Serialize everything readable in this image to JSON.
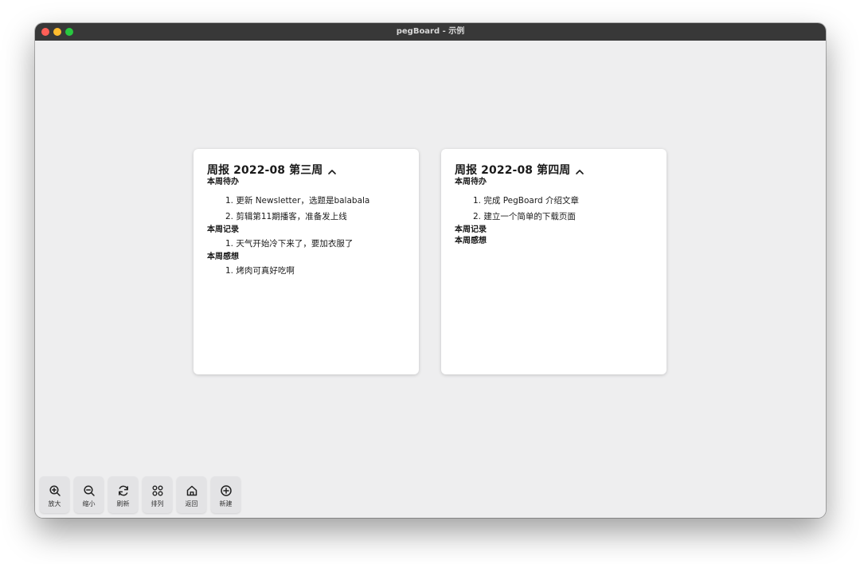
{
  "window": {
    "title": "pegBoard - 示例"
  },
  "cards": [
    {
      "title": "周报 2022-08 第三周",
      "sections": [
        {
          "heading": "本周待办",
          "items": [
            "1. 更新 Newsletter，选题是balabala",
            "2. 剪辑第11期播客，准备发上线"
          ]
        },
        {
          "heading": "本周记录",
          "items": [
            "1. 天气开始冷下来了，要加衣服了"
          ]
        },
        {
          "heading": "本周感想",
          "items": [
            "1. 烤肉可真好吃啊"
          ]
        }
      ]
    },
    {
      "title": "周报 2022-08 第四周",
      "sections": [
        {
          "heading": "本周待办",
          "items": [
            "1. 完成 PegBoard 介绍文章",
            "2. 建立一个简单的下载页面"
          ]
        },
        {
          "heading": "本周记录",
          "items": []
        },
        {
          "heading": "本周感想",
          "items": []
        }
      ]
    }
  ],
  "toolbar": [
    {
      "label": "放大",
      "icon": "zoom-in-icon"
    },
    {
      "label": "缩小",
      "icon": "zoom-out-icon"
    },
    {
      "label": "刷新",
      "icon": "refresh-icon"
    },
    {
      "label": "排列",
      "icon": "arrange-icon"
    },
    {
      "label": "返回",
      "icon": "home-icon"
    },
    {
      "label": "新建",
      "icon": "add-icon"
    }
  ]
}
